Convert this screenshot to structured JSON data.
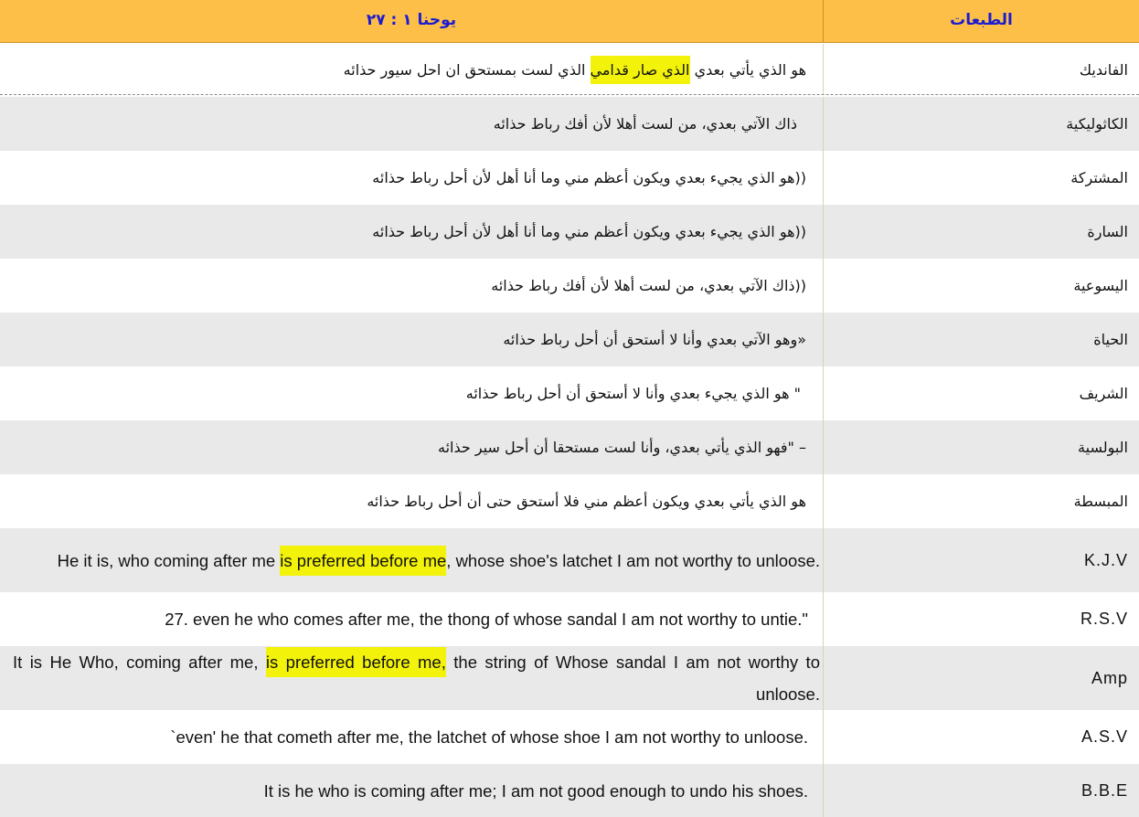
{
  "header": {
    "versions_label": "الطبعات",
    "reference": "يوحنا ١ : ٢٧"
  },
  "rows": [
    {
      "version": "الفانديك",
      "before": "هو الذي يأتي بعدي ",
      "highlight": "الذي صار قدامي",
      "after": " الذي لست بمستحق ان احل سيور حذائه"
    },
    {
      "version": "الكاثوليكية",
      "text": "ذاك الآتي بعدي، من لست أهلا لأن أفك رباط حذائه"
    },
    {
      "version": "المشتركة",
      "text": "((هو الذي يجيء بعدي  ويكون أعظم مني  وما أنا أهل لأن أحل رباط حذائه"
    },
    {
      "version": "السارة",
      "text": "((هو الذي يجيء بعدي  ويكون أعظم مني  وما أنا أهل لأن أحل رباط حذائه"
    },
    {
      "version": "اليسوعية",
      "text": "((ذاك الآتي بعدي، من لست أهلا لأن أفك رباط حذائه"
    },
    {
      "version": "الحياة",
      "text": "«وهو الآتي بعدي  وأنا لا أستحق أن أحل رباط حذائه"
    },
    {
      "version": "الشريف",
      "text": "\" هو الذي يجيء بعدي  وأنا لا أستحق أن أحل رباط حذائه"
    },
    {
      "version": "البولسية",
      "text": "–  \"فهو الذي يأتي بعدي، وأنا لست مستحقا أن أحل سير حذائه"
    },
    {
      "version": "المبسطة",
      "text": "هو الذي يأتي بعدي  ويكون أعظم مني  فلا أستحق حتى أن أحل رباط حذائه"
    },
    {
      "version": "K.J.V",
      "before": "He it is, who coming after me ",
      "highlight": "is preferred before me",
      "after": ", whose shoe's latchet I am not worthy to unloose."
    },
    {
      "version": "R.S.V",
      "text": "27. even he who comes after me, the thong of whose sandal I am not worthy to untie.\""
    },
    {
      "version": "Amp",
      "before": "It is He Who, coming after me, ",
      "highlight": "is preferred before me,",
      "after": " the string of Whose sandal I am not worthy to unloose."
    },
    {
      "version": "A.S.V",
      "text": "`even' he that cometh after me, the latchet of whose shoe I am not worthy to unloose."
    },
    {
      "version": "B.B.E",
      "text": "It is he who is coming after me; I am not good enough to undo his shoes."
    }
  ]
}
